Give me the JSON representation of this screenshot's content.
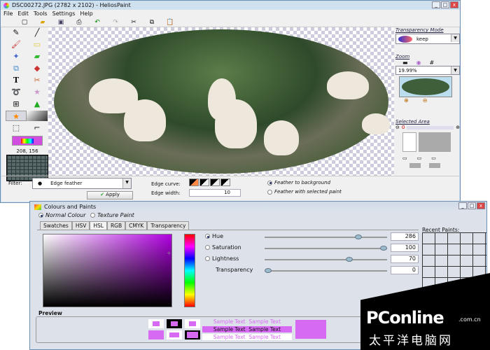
{
  "window": {
    "title": "DSC00272.JPG (2782 x 2102) - HeliosPaint",
    "min": "_",
    "max": "□",
    "close": "x"
  },
  "menu": [
    "File",
    "Edit",
    "Tools",
    "Settings",
    "Help"
  ],
  "toolbar_icons": [
    "new-icon",
    "open-icon",
    "save-icon",
    "print-icon",
    "undo-icon",
    "redo-icon",
    "cut-icon",
    "copy-icon",
    "paste-icon"
  ],
  "tools": [
    "pencil",
    "line",
    "brush",
    "eraser",
    "spray",
    "highlighter",
    "clone",
    "fill",
    "text",
    "select-cut",
    "lasso",
    "magic-wand",
    "resize",
    "shapes",
    "gradient-selected",
    "gradient",
    "crop",
    "eyedropper"
  ],
  "coords": "208, 156",
  "filter": {
    "label": "Filter:",
    "value": "Edge feather",
    "apply": "Apply",
    "edge_curve_label": "Edge curve:",
    "edge_width_label": "Edge width:",
    "edge_width": "10",
    "opt1": "Feather to background",
    "opt2": "Feather with selected paint"
  },
  "right": {
    "transparency_label": "Transparency Mode",
    "transparency_value": "keep",
    "zoom_label": "Zoom",
    "zoom_value": "19.99%",
    "selected_area_label": "Selected Area",
    "selected_value": "0"
  },
  "dialog": {
    "title": "Colours and Paints",
    "normal": "Normal Colour",
    "texture": "Texture Paint",
    "tabs": [
      "Swatches",
      "HSV",
      "HSL",
      "RGB",
      "CMYK",
      "Transparency"
    ],
    "active_tab": "HSL",
    "rows": [
      {
        "label": "Hue",
        "value": "286",
        "pos": 0.78
      },
      {
        "label": "Saturation",
        "value": "100",
        "pos": 1.0
      },
      {
        "label": "Lightness",
        "value": "70",
        "pos": 0.7
      },
      {
        "label": "Transparency",
        "value": "0",
        "pos": 0.0
      }
    ],
    "recent_label": "Recent Paints:",
    "preview_label": "Preview",
    "sample": "Sample Text"
  },
  "colors": {
    "paint": "#d66af2"
  },
  "watermark": {
    "brand": "PConline",
    "domain": ".com.cn",
    "cn": "太平洋电脑网"
  }
}
